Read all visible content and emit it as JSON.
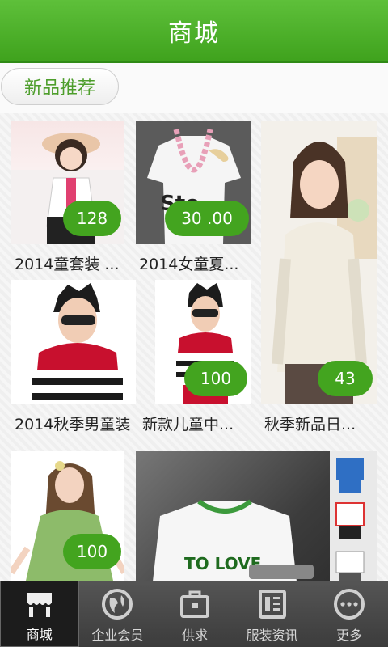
{
  "header": {
    "title": "商城"
  },
  "tab": {
    "label": "新品推荐"
  },
  "products": [
    {
      "price": "128",
      "caption": "2014童套装 ..."
    },
    {
      "price": "30 .00",
      "caption": "2014女童夏..."
    },
    {
      "price": "43",
      "caption": "秋季新品日..."
    },
    {
      "price": "100",
      "caption": "2014秋季男童装"
    },
    {
      "price": "100",
      "caption": "新款儿童中..."
    },
    {
      "price": "100",
      "caption": ""
    },
    {
      "price": "",
      "caption": ""
    }
  ],
  "tshirt_text": "TO LOVE",
  "nav": [
    {
      "label": "商城",
      "icon": "store-icon"
    },
    {
      "label": "企业会员",
      "icon": "globe-icon"
    },
    {
      "label": "供求",
      "icon": "briefcase-icon"
    },
    {
      "label": "服装资讯",
      "icon": "news-icon"
    },
    {
      "label": "更多",
      "icon": "more-icon"
    }
  ],
  "colors": {
    "accent": "#43a41f",
    "header": "#4cb12a",
    "navbar": "#444444"
  }
}
